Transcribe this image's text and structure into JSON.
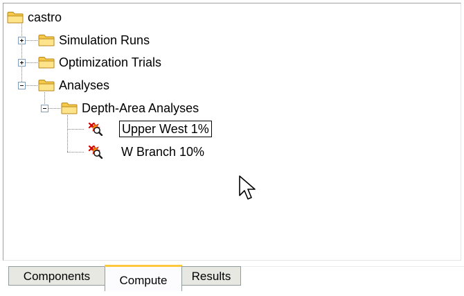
{
  "tree": {
    "root": {
      "label": "castro"
    },
    "children": [
      {
        "label": "Simulation Runs",
        "state": "collapsed"
      },
      {
        "label": "Optimization Trials",
        "state": "collapsed"
      },
      {
        "label": "Analyses",
        "state": "expanded",
        "children": [
          {
            "label": "Depth-Area Analyses",
            "state": "expanded",
            "children": [
              {
                "label": "Upper West 1%",
                "icon": "depth-area-analysis-icon",
                "selected": true
              },
              {
                "label": "W Branch 10%",
                "icon": "depth-area-analysis-icon",
                "selected": false
              }
            ]
          }
        ]
      }
    ]
  },
  "tabs": [
    {
      "label": "Components",
      "active": false
    },
    {
      "label": "Compute",
      "active": true
    },
    {
      "label": "Results",
      "active": false
    }
  ],
  "colors": {
    "folder_fill": "#fddc6e",
    "folder_outline": "#c19a2d",
    "tab_active_highlight": "#ffc83c"
  }
}
